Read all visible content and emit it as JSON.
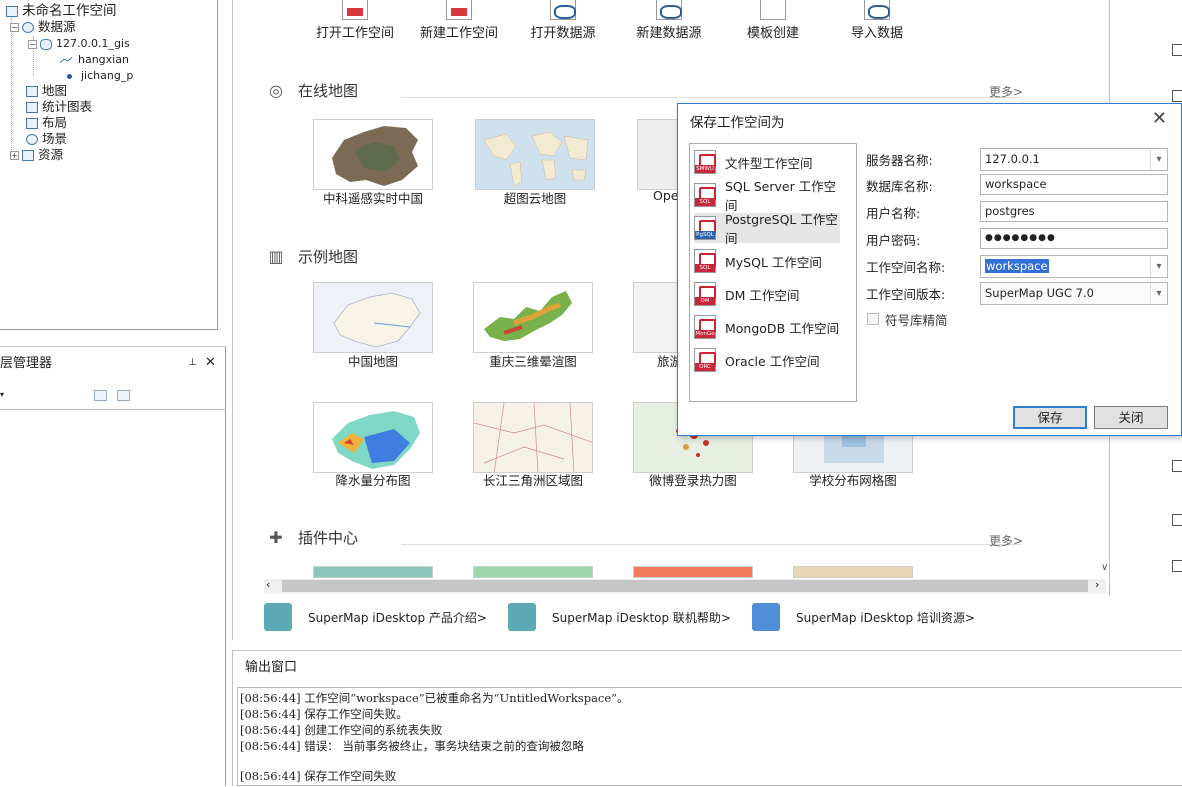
{
  "workspace_tree": {
    "root": "未命名工作空间",
    "datasources": "数据源",
    "datasource": "127.0.0.1_gis",
    "datasets": [
      "hangxian",
      "jichang_p"
    ],
    "items": [
      "地图",
      "统计图表",
      "布局",
      "场景",
      "资源"
    ]
  },
  "layer_manager": {
    "title": "层管理器",
    "pin": "ᵖ",
    "close": "✕"
  },
  "toolbar": [
    "打开工作空间",
    "新建工作空间",
    "打开数据源",
    "新建数据源",
    "模板创建",
    "导入数据"
  ],
  "online_maps": {
    "title": "在线地图",
    "more": "更多>",
    "cards": [
      "中科遥感实时中国",
      "超图云地图",
      "Oper"
    ]
  },
  "sample_maps": {
    "title": "示例地图",
    "cards_row1": [
      "中国地图",
      "重庆三维晕渲图",
      "旅游"
    ],
    "cards_row2": [
      "降水量分布图",
      "长江三角洲区域图",
      "微博登录热力图",
      "学校分布网格图"
    ]
  },
  "plugins": {
    "title": "插件中心",
    "more": "更多>"
  },
  "footer_links": [
    "SuperMap iDesktop 产品介绍>",
    "SuperMap iDesktop 联机帮助>",
    "SuperMap iDesktop 培训资源>"
  ],
  "output": {
    "title": "输出窗口",
    "lines": [
      "[08:56:44] 工作空间“workspace”已被重命名为“UntitledWorkspace”。",
      "[08:56:44] 保存工作空间失败。",
      "[08:56:44] 创建工作空间的系统表失败",
      "[08:56:44] 错误：  当前事务被终止，事务块结束之前的查询被忽略",
      "",
      "[08:56:44] 保存工作空间失败"
    ]
  },
  "dialog": {
    "title": "保存工作空间为",
    "close": "✕",
    "types": [
      {
        "label": "文件型工作空间",
        "badge": "SMWU"
      },
      {
        "label": "SQL Server 工作空间",
        "badge": "SQL"
      },
      {
        "label": "PostgreSQL 工作空间",
        "badge": "PgSQL"
      },
      {
        "label": "MySQL 工作空间",
        "badge": "SQL"
      },
      {
        "label": "DM 工作空间",
        "badge": "DM"
      },
      {
        "label": "MongoDB 工作空间",
        "badge": "MonGo"
      },
      {
        "label": "Oracle 工作空间",
        "badge": "ORC"
      }
    ],
    "selected_type": "PostgreSQL 工作空间",
    "labels": {
      "server": "服务器名称:",
      "database": "数据库名称:",
      "user": "用户名称:",
      "password": "用户密码:",
      "ws_name": "工作空间名称:",
      "ws_version": "工作空间版本:",
      "symbol": "符号库精简"
    },
    "values": {
      "server": "127.0.0.1",
      "database": "workspace",
      "user": "postgres",
      "password": "●●●●●●●●",
      "ws_name": "workspace",
      "ws_version": "SuperMap UGC 7.0"
    },
    "save": "保存",
    "cancel": "关闭"
  },
  "colors": {
    "accent": "#2f7fd0",
    "selection": "#3170d7"
  }
}
